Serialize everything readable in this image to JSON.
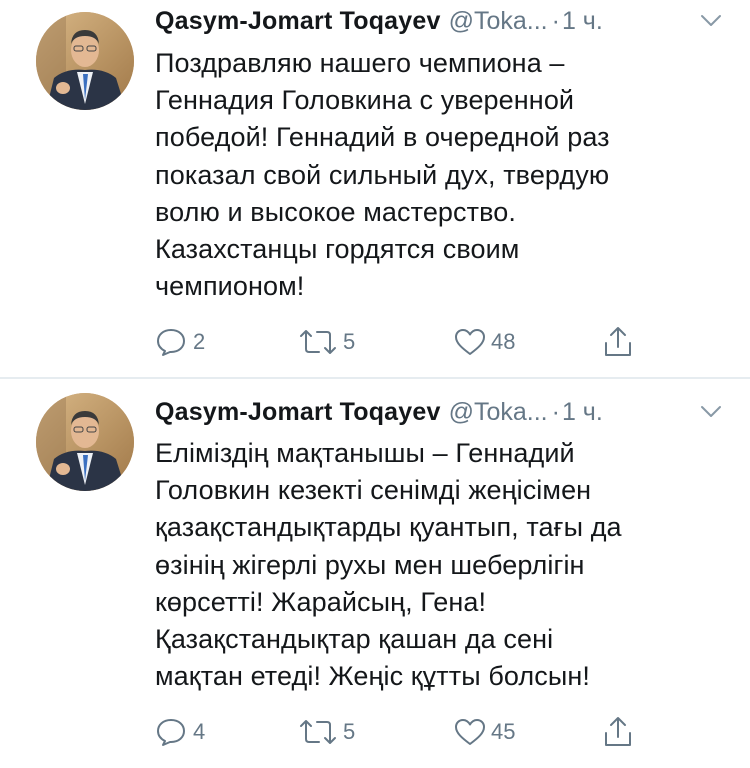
{
  "colors": {
    "text": "#14171a",
    "secondary": "#657786",
    "separator": "#e6ecf0"
  },
  "tweets": [
    {
      "author_name": "Qasym-Jomart Toqayev",
      "handle": "@Toka...",
      "dot": "·",
      "time": "1 ч.",
      "text_lines": [
        "Поздравляю нашего чемпиона –",
        "Геннадия Головкина с уверенной",
        "победой! Геннадий в очередной раз",
        "показал свой сильный дух, твердую",
        "волю и высокое мастерство.",
        "Казахстанцы гордятся своим",
        "чемпионом!"
      ],
      "replies": "2",
      "retweets": "5",
      "likes": "48",
      "icons": [
        "avatar",
        "chevron-down-icon",
        "reply-icon",
        "retweet-icon",
        "like-icon",
        "share-icon"
      ]
    },
    {
      "author_name": "Qasym-Jomart Toqayev",
      "handle": "@Toka...",
      "dot": "·",
      "time": "1 ч.",
      "text_lines": [
        "Еліміздің мақтанышы – Геннадий",
        "Головкин кезекті сенімді жеңісімен",
        "қазақстандықтарды қуантып, тағы да",
        "өзінің жігерлі рухы мен шеберлігін",
        "көрсетті! Жарайсың, Гена!",
        "Қазақстандықтар қашан да сені",
        "мақтан етеді! Жеңіс құтты болсын!"
      ],
      "replies": "4",
      "retweets": "5",
      "likes": "45",
      "icons": [
        "avatar",
        "chevron-down-icon",
        "reply-icon",
        "retweet-icon",
        "like-icon",
        "share-icon"
      ]
    }
  ]
}
